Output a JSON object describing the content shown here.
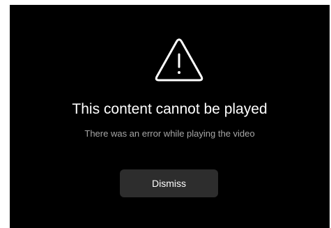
{
  "dialog": {
    "icon": "warning-triangle-icon",
    "title": "This content cannot be played",
    "message": "There was an error while playing the video",
    "dismiss_label": "Dismiss"
  },
  "colors": {
    "background": "#000000",
    "title_text": "#ffffff",
    "message_text": "#a6a6a6",
    "button_background": "#2d2d2d",
    "button_text": "#ffffff"
  }
}
